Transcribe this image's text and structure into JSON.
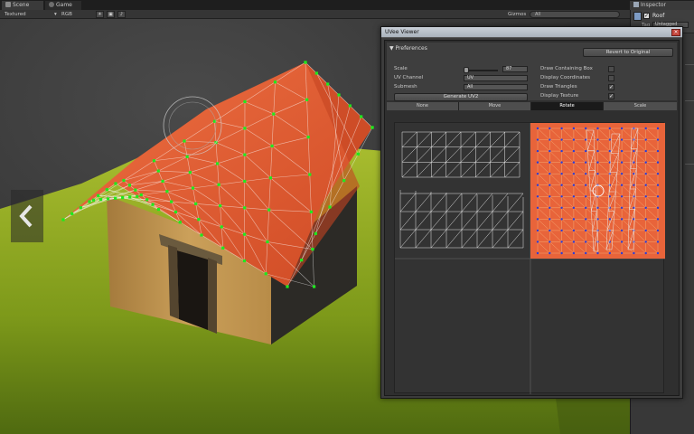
{
  "tabs": {
    "scene": "Scene",
    "game": "Game",
    "inspector": "Inspector"
  },
  "toolbar": {
    "render_mode": "Textured",
    "color_mode": "RGB",
    "gizmos": "Gizmos",
    "search_hint": "All"
  },
  "inspector": {
    "object_name": "Roof",
    "tag_label": "Tag",
    "tag_value": "Untagged"
  },
  "uv_window": {
    "title": "UVee Viewer",
    "preferences_label": "Preferences",
    "revert_label": "Revert to Original",
    "scale_label": "Scale",
    "scale_value": "87",
    "uv_channel_label": "UV Channel",
    "uv_channel_value": "UV",
    "submesh_label": "Submesh",
    "submesh_value": "All",
    "generate_label": "Generate UV2",
    "options": [
      {
        "label": "Draw Containing Box",
        "checked": false
      },
      {
        "label": "Display Coordinates",
        "checked": false
      },
      {
        "label": "Draw Triangles",
        "checked": true
      },
      {
        "label": "Display Texture",
        "checked": true
      }
    ],
    "modes": [
      "None",
      "Move",
      "Rotate",
      "Scale"
    ],
    "active_mode": "Rotate"
  },
  "colors": {
    "roof": "#e2592e",
    "grass": "#8aa31f",
    "vertex": "#1eea1e",
    "wall": "#b48a4a",
    "uv_texture": "#e8643a"
  },
  "icons": [
    "scene-icon",
    "game-icon",
    "inspector-icon",
    "nav-left-arrow-icon",
    "nav-right-arrow-icon",
    "close-icon"
  ]
}
